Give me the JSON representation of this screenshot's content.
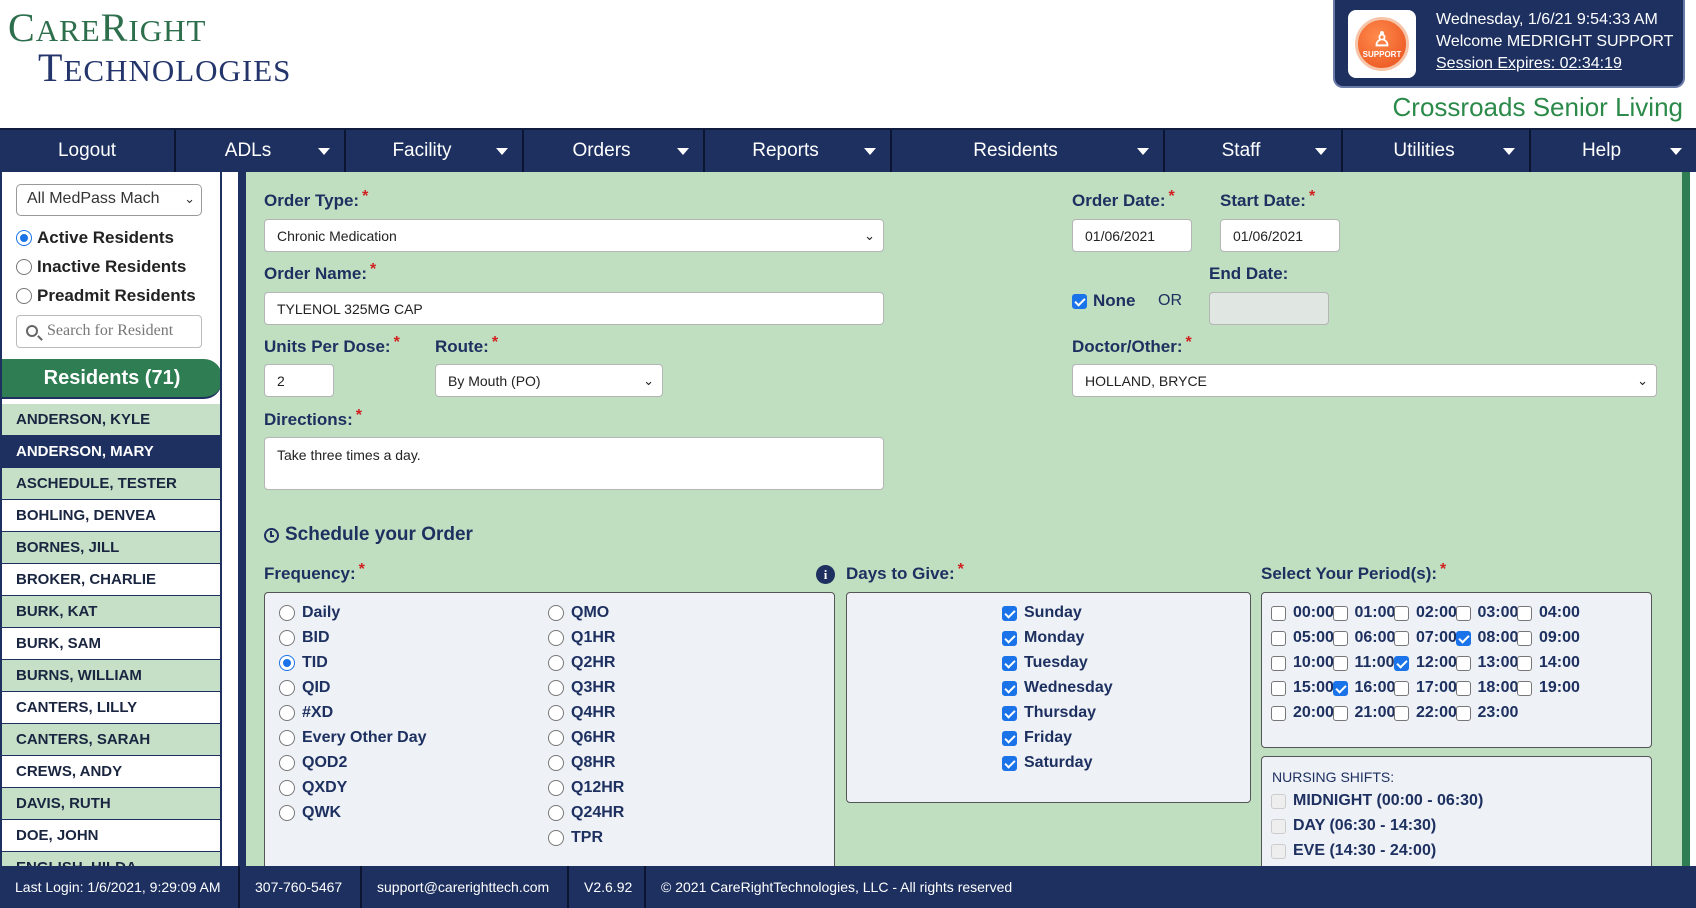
{
  "brand": {
    "line1_big": "C",
    "line1_rest": "ARE",
    "line1_big2": "R",
    "line1_rest2": "IGHT",
    "line2_big": "T",
    "line2_rest": "ECHNOLOGIES"
  },
  "session": {
    "datetime": "Wednesday, 1/6/21 9:54:33 AM",
    "welcome": "Welcome MEDRIGHT SUPPORT",
    "expires": "Session Expires: 02:34:19",
    "icon_label": "SUPPORT"
  },
  "facility": "Crossroads Senior Living",
  "nav": {
    "logout": "Logout",
    "adls": "ADLs",
    "facility": "Facility",
    "orders": "Orders",
    "reports": "Reports",
    "residents": "Residents",
    "staff": "Staff",
    "utilities": "Utilities",
    "help": "Help"
  },
  "sidebar": {
    "machine_select": "All MedPass Mach",
    "active": "Active Residents",
    "inactive": "Inactive Residents",
    "preadmit": "Preadmit Residents",
    "search_placeholder": "Search for Resident",
    "residents_header": "Residents (71)",
    "residents": [
      "ANDERSON, KYLE",
      "ANDERSON, MARY",
      "ASCHEDULE, TESTER",
      "BOHLING, DENVEA",
      "BORNES, JILL",
      "BROKER, CHARLIE",
      "BURK, KAT",
      "BURK, SAM",
      "BURNS, WILLIAM",
      "CANTERS, LILLY",
      "CANTERS, SARAH",
      "CREWS, ANDY",
      "DAVIS, RUTH",
      "DOE, JOHN",
      "ENGLISH, HILDA"
    ]
  },
  "order": {
    "type_label": "Order Type:",
    "type_value": "Chronic Medication",
    "name_label": "Order Name:",
    "name_value": "TYLENOL 325MG CAP",
    "units_label": "Units Per Dose:",
    "units_value": "2",
    "route_label": "Route:",
    "route_value": "By Mouth (PO)",
    "directions_label": "Directions:",
    "directions_value": "Take three times a day.",
    "order_date_label": "Order Date:",
    "order_date_value": "01/06/2021",
    "start_date_label": "Start Date:",
    "start_date_value": "01/06/2021",
    "end_date_label": "End Date:",
    "none_label": "None",
    "or_label": "OR",
    "doctor_label": "Doctor/Other:",
    "doctor_value": "HOLLAND, BRYCE",
    "required_mark": "*"
  },
  "schedule": {
    "title": "Schedule your Order",
    "frequency_label": "Frequency:",
    "days_label": "Days to Give:",
    "periods_label": "Select Your Period(s):",
    "info_glyph": "i",
    "freq_col1": [
      "Daily",
      "BID",
      "TID",
      "QID",
      "#XD",
      "Every Other Day",
      "QOD2",
      "QXDY",
      "QWK"
    ],
    "freq_col2": [
      "QMO",
      "Q1HR",
      "Q2HR",
      "Q3HR",
      "Q4HR",
      "Q6HR",
      "Q8HR",
      "Q12HR",
      "Q24HR",
      "TPR"
    ],
    "freq_selected": "TID",
    "days": [
      "Sunday",
      "Monday",
      "Tuesday",
      "Wednesday",
      "Thursday",
      "Friday",
      "Saturday"
    ],
    "periods": [
      "00:00",
      "01:00",
      "02:00",
      "03:00",
      "04:00",
      "05:00",
      "06:00",
      "07:00",
      "08:00",
      "09:00",
      "10:00",
      "11:00",
      "12:00",
      "13:00",
      "14:00",
      "15:00",
      "16:00",
      "17:00",
      "18:00",
      "19:00",
      "20:00",
      "21:00",
      "22:00",
      "23:00"
    ],
    "periods_checked": [
      "08:00",
      "12:00",
      "16:00"
    ],
    "shifts_title": "NURSING SHIFTS:",
    "shifts": [
      "MIDNIGHT (00:00 - 06:30)",
      "DAY (06:30 - 14:30)",
      "EVE (14:30 - 24:00)"
    ]
  },
  "footer": {
    "last_login": "Last Login: 1/6/2021, 9:29:09 AM",
    "phone": "307-760-5467",
    "email": "support@carerighttech.com",
    "version": "V2.6.92",
    "copyright": "© 2021 CareRightTechnologies, LLC - All rights reserved"
  },
  "colors": {
    "navy": "#1d3060",
    "green": "#2f7d52",
    "panel": "#c0dfc1",
    "required": "#d12020"
  }
}
